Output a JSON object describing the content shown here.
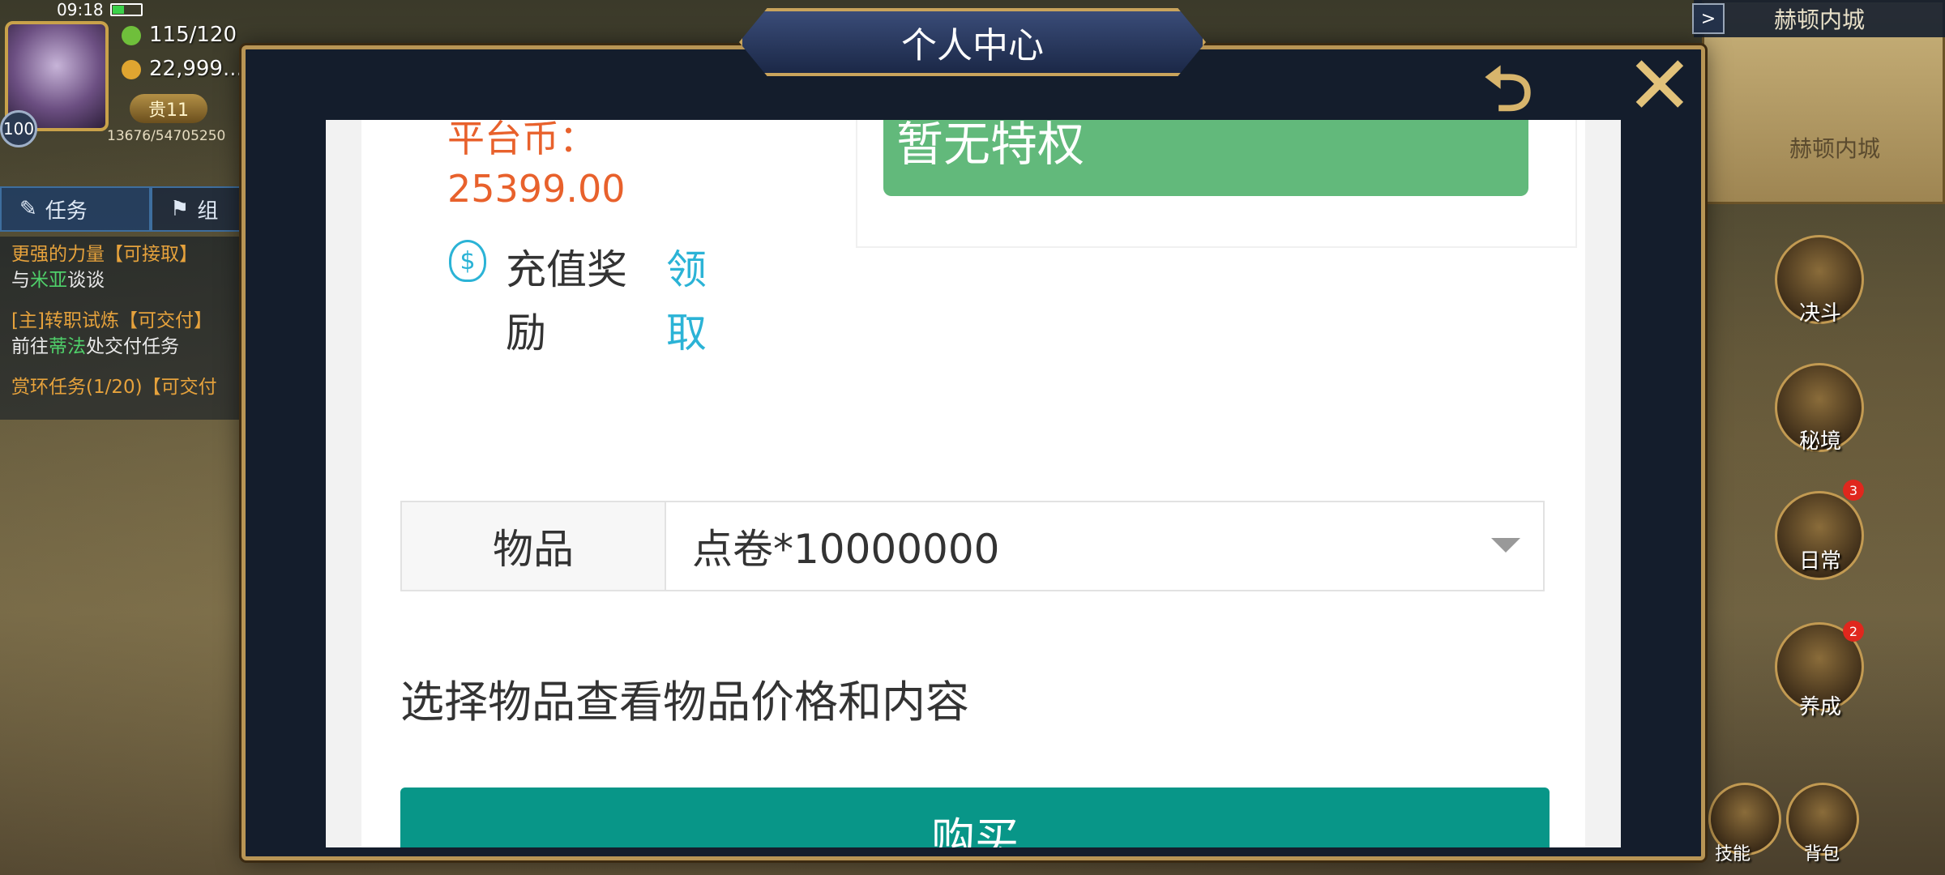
{
  "status": {
    "time": "09:18"
  },
  "player": {
    "level": "100",
    "stamina": "115/120",
    "gold": "22,999...",
    "vip": "贵11",
    "exp": "13676/54705250"
  },
  "quest_tabs": [
    {
      "label": "任务",
      "icon": "scroll-icon"
    },
    {
      "label": "组",
      "icon": "flag-icon"
    }
  ],
  "quests": [
    {
      "title": "更强的力量【可接取】",
      "desc_prefix": "与",
      "desc_highlight": "米亚",
      "desc_suffix": "谈谈"
    },
    {
      "title": "[主]转职试炼【可交付】",
      "desc_prefix": "前往",
      "desc_highlight": "蒂法",
      "desc_suffix": "处交付任务"
    },
    {
      "title": "赏环任务(1/20)【可交付",
      "desc_prefix": "",
      "desc_highlight": "",
      "desc_suffix": ""
    }
  ],
  "map": {
    "title": "赫顿内城",
    "location": "赫顿内城",
    "arrow": ">"
  },
  "side_buttons": [
    {
      "label": "决斗",
      "badge": ""
    },
    {
      "label": "秘境",
      "badge": ""
    },
    {
      "label": "日常",
      "badge": "3"
    },
    {
      "label": "养成",
      "badge": "2"
    },
    {
      "label": "技能",
      "badge": ""
    },
    {
      "label": "背包",
      "badge": ""
    }
  ],
  "modal": {
    "title": "个人中心",
    "back_icon": "back-arrow-icon",
    "close_icon": "close-icon"
  },
  "account": {
    "coin_label": "平台币：",
    "coin_value": "25399.00",
    "recharge_label": "充值奖励",
    "claim_label": "领取",
    "privilege": "暂无特权"
  },
  "shop": {
    "item_label": "物品",
    "item_value": "点卷*10000000",
    "hint": "选择物品查看物品价格和内容",
    "buy_label": "购买"
  },
  "colors": {
    "accent_orange": "#e8612c",
    "link_blue": "#2bb3d6",
    "privilege_green": "#62b97b",
    "buy_teal": "#089688",
    "frame_gold": "#b89555"
  }
}
